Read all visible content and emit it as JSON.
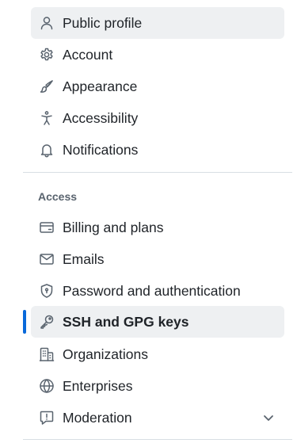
{
  "account_group": {
    "items": [
      {
        "label": "Public profile",
        "icon": "person-icon"
      },
      {
        "label": "Account",
        "icon": "gear-icon"
      },
      {
        "label": "Appearance",
        "icon": "paintbrush-icon"
      },
      {
        "label": "Accessibility",
        "icon": "accessibility-icon"
      },
      {
        "label": "Notifications",
        "icon": "bell-icon"
      }
    ]
  },
  "access_group": {
    "heading": "Access",
    "items": [
      {
        "label": "Billing and plans",
        "icon": "credit-card-icon"
      },
      {
        "label": "Emails",
        "icon": "mail-icon"
      },
      {
        "label": "Password and authentication",
        "icon": "shield-lock-icon"
      },
      {
        "label": "SSH and GPG keys",
        "icon": "key-icon",
        "selected": true
      },
      {
        "label": "Organizations",
        "icon": "organization-icon"
      },
      {
        "label": "Enterprises",
        "icon": "globe-icon"
      },
      {
        "label": "Moderation",
        "icon": "report-icon",
        "expandable": true
      }
    ]
  },
  "colors": {
    "accent": "#0969da",
    "selected_bg": "#eef0f2",
    "text": "#1f2328",
    "muted": "#59636e",
    "divider": "#d8dee4"
  }
}
